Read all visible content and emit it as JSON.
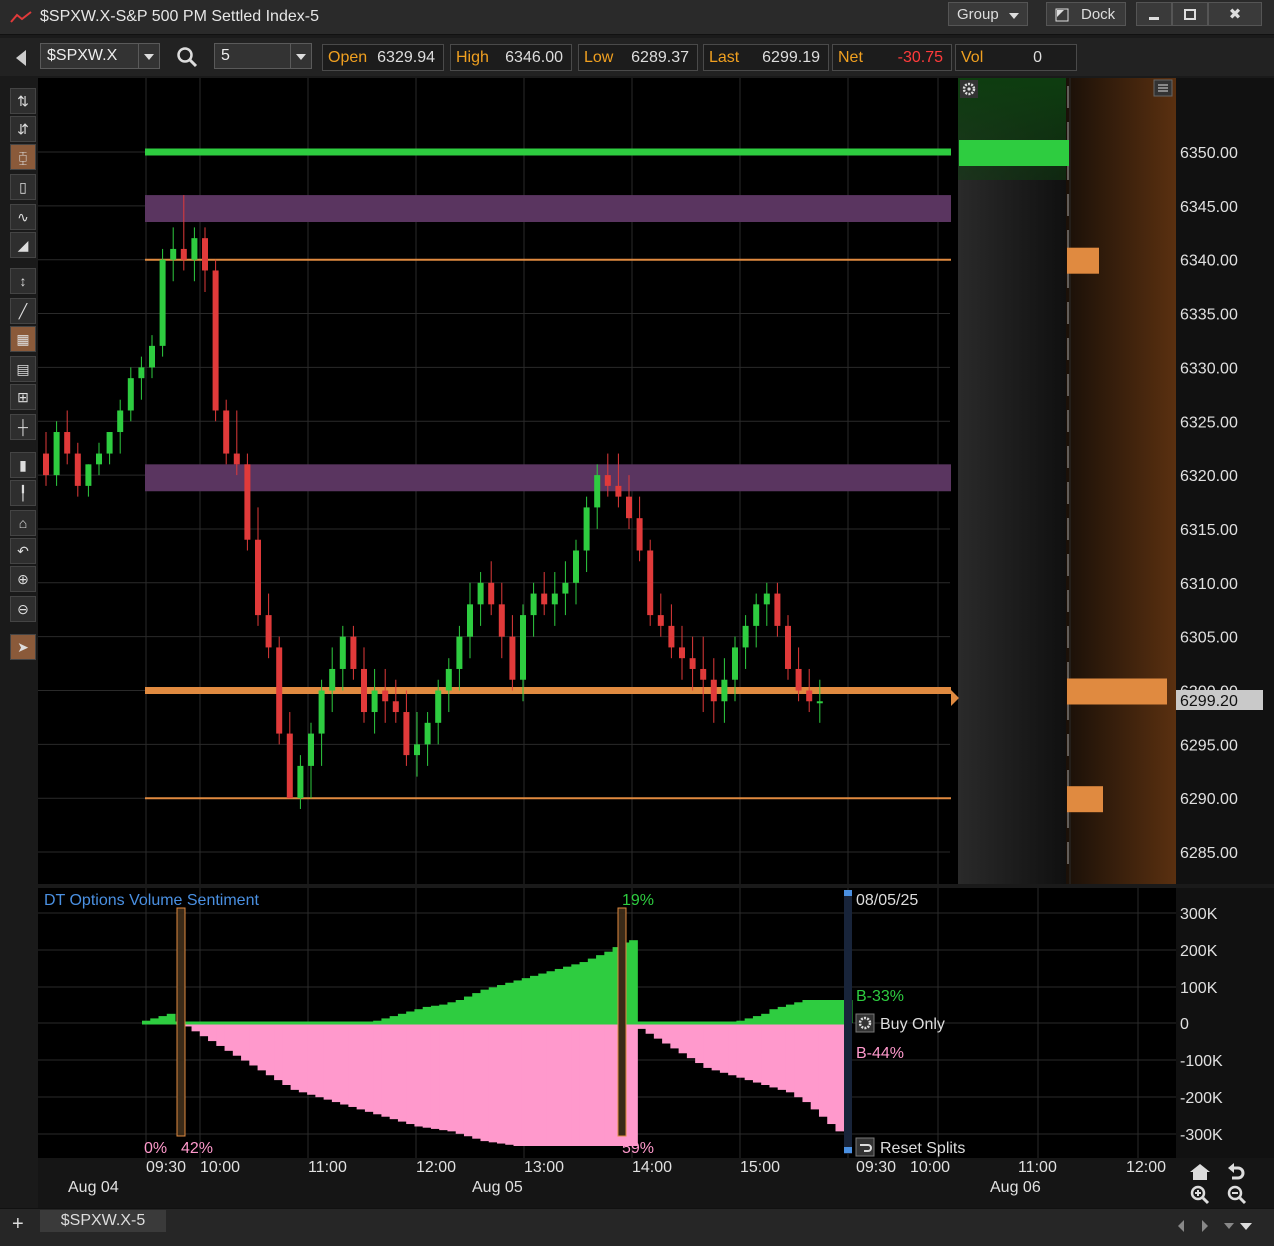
{
  "window": {
    "title": "$SPXW.X-S&P 500 PM Settled Index-5",
    "group_label": "Group",
    "dock_label": "Dock",
    "minimize_icon": "minimize-icon",
    "maximize_icon": "maximize-icon",
    "close_label": "✖"
  },
  "toolbar": {
    "symbol": "$SPXW.X",
    "interval": "5",
    "quotes": [
      {
        "label": "Open",
        "value": "6329.94"
      },
      {
        "label": "High",
        "value": "6346.00"
      },
      {
        "label": "Low",
        "value": "6289.37"
      },
      {
        "label": "Last",
        "value": "6299.19"
      },
      {
        "label": "Net",
        "value": "-30.75"
      },
      {
        "label": "Vol",
        "value": "0"
      }
    ],
    "net_color": "#ff3b3b",
    "label_color": "#f0a020"
  },
  "price_axis": {
    "ticks": [
      "6350.00",
      "6345.00",
      "6340.00",
      "6335.00",
      "6330.00",
      "6325.00",
      "6320.00",
      "6315.00",
      "6310.00",
      "6305.00",
      "6300.00",
      "6295.00",
      "6290.00",
      "6285.00"
    ],
    "last_price_tag": "6299.20"
  },
  "volume_panel": {
    "title": "DT Options Volume Sentiment",
    "date_label": "08/05/25",
    "buy_pct": "B-33%",
    "sell_pct": "B-44%",
    "buy_only_label": "Buy Only",
    "reset_splits_label": "Reset Splits",
    "split_labels": {
      "start": "0%",
      "first": "42%",
      "peak": "19%",
      "second": "59%"
    },
    "axis_ticks": [
      "300K",
      "200K",
      "100K",
      "0",
      "-100K",
      "-200K",
      "-300K"
    ],
    "buy_color": "#2ecc40",
    "sell_color": "#ff99cc"
  },
  "time_axis": {
    "times": [
      "09:30",
      "10:00",
      "11:00",
      "12:00",
      "13:00",
      "14:00",
      "15:00",
      "09:30",
      "10:00",
      "11:00",
      "12:00"
    ],
    "dates": [
      "Aug 04",
      "Aug 05",
      "Aug 06"
    ]
  },
  "tabs": {
    "add_label": "+",
    "active_tab": "$SPXW.X-5"
  },
  "chart_data": {
    "type": "candlestick",
    "symbol": "$SPXW.X",
    "interval": "5",
    "ylim": [
      6283,
      6357
    ],
    "candles": [
      [
        6322,
        6324,
        6319,
        6320
      ],
      [
        6320,
        6325,
        6319,
        6324
      ],
      [
        6324,
        6326,
        6321,
        6322
      ],
      [
        6322,
        6323,
        6318,
        6319
      ],
      [
        6319,
        6321,
        6318,
        6321
      ],
      [
        6321,
        6323,
        6320,
        6322
      ],
      [
        6322,
        6324,
        6321,
        6324
      ],
      [
        6324,
        6327,
        6322,
        6326
      ],
      [
        6326,
        6330,
        6325,
        6329
      ],
      [
        6329,
        6331,
        6327,
        6330
      ],
      [
        6330,
        6333,
        6329,
        6332
      ],
      [
        6332,
        6341,
        6331,
        6340
      ],
      [
        6340,
        6343,
        6338,
        6341
      ],
      [
        6341,
        6346,
        6339,
        6340
      ],
      [
        6340,
        6343,
        6338,
        6342
      ],
      [
        6342,
        6343,
        6337,
        6339
      ],
      [
        6339,
        6340,
        6325,
        6326
      ],
      [
        6326,
        6327,
        6321,
        6322
      ],
      [
        6322,
        6326,
        6320,
        6321
      ],
      [
        6321,
        6322,
        6313,
        6314
      ],
      [
        6314,
        6317,
        6306,
        6307
      ],
      [
        6307,
        6309,
        6303,
        6304
      ],
      [
        6304,
        6305,
        6295,
        6296
      ],
      [
        6296,
        6298,
        6290,
        6290
      ],
      [
        6290,
        6294,
        6289,
        6293
      ],
      [
        6293,
        6297,
        6290,
        6296
      ],
      [
        6296,
        6301,
        6293,
        6300
      ],
      [
        6300,
        6304,
        6298,
        6302
      ],
      [
        6302,
        6306,
        6300,
        6305
      ],
      [
        6305,
        6306,
        6301,
        6302
      ],
      [
        6302,
        6304,
        6297,
        6298
      ],
      [
        6298,
        6302,
        6296,
        6300
      ],
      [
        6300,
        6302,
        6297,
        6299
      ],
      [
        6299,
        6301,
        6297,
        6298
      ],
      [
        6298,
        6300,
        6293,
        6294
      ],
      [
        6294,
        6298,
        6292,
        6295
      ],
      [
        6295,
        6298,
        6293,
        6297
      ],
      [
        6297,
        6301,
        6295,
        6300
      ],
      [
        6300,
        6303,
        6298,
        6302
      ],
      [
        6302,
        6306,
        6300,
        6305
      ],
      [
        6305,
        6310,
        6303,
        6308
      ],
      [
        6308,
        6311,
        6306,
        6310
      ],
      [
        6310,
        6312,
        6307,
        6308
      ],
      [
        6308,
        6310,
        6303,
        6305
      ],
      [
        6305,
        6307,
        6300,
        6301
      ],
      [
        6301,
        6308,
        6299,
        6307
      ],
      [
        6307,
        6310,
        6305,
        6309
      ],
      [
        6309,
        6311,
        6307,
        6308
      ],
      [
        6308,
        6311,
        6306,
        6309
      ],
      [
        6309,
        6312,
        6307,
        6310
      ],
      [
        6310,
        6314,
        6308,
        6313
      ],
      [
        6313,
        6318,
        6311,
        6317
      ],
      [
        6317,
        6321,
        6315,
        6320
      ],
      [
        6320,
        6322,
        6318,
        6319
      ],
      [
        6319,
        6322,
        6317,
        6318
      ],
      [
        6318,
        6320,
        6315,
        6316
      ],
      [
        6316,
        6318,
        6312,
        6313
      ],
      [
        6313,
        6314,
        6306,
        6307
      ],
      [
        6307,
        6309,
        6305,
        6306
      ],
      [
        6306,
        6308,
        6303,
        6304
      ],
      [
        6304,
        6306,
        6301,
        6303
      ],
      [
        6303,
        6305,
        6300,
        6302
      ],
      [
        6302,
        6305,
        6298,
        6301
      ],
      [
        6301,
        6303,
        6297,
        6299
      ],
      [
        6299,
        6303,
        6297,
        6301
      ],
      [
        6301,
        6305,
        6299,
        6304
      ],
      [
        6304,
        6307,
        6302,
        6306
      ],
      [
        6306,
        6309,
        6304,
        6308
      ],
      [
        6308,
        6310,
        6306,
        6309
      ],
      [
        6309,
        6310,
        6305,
        6306
      ],
      [
        6306,
        6307,
        6301,
        6302
      ],
      [
        6302,
        6304,
        6299,
        6300
      ],
      [
        6300,
        6302,
        6298,
        6299
      ],
      [
        6299,
        6301,
        6297,
        6299
      ]
    ],
    "levels": [
      {
        "price": 6350,
        "color": "#2ecc40",
        "width": "thick"
      },
      {
        "price": 6340,
        "color": "#e08a40",
        "width": "thin"
      },
      {
        "price": 6300,
        "color": "#e08a40",
        "width": "thick"
      },
      {
        "price": 6290,
        "color": "#e08a40",
        "width": "thin"
      }
    ],
    "zones": [
      {
        "from": 6343.5,
        "to": 6346,
        "color": "#5a3560"
      },
      {
        "from": 6318.5,
        "to": 6321,
        "color": "#5a3560"
      }
    ],
    "volume_profile": [
      {
        "price": 6350,
        "color": "#2ecc40",
        "size": 0.5
      },
      {
        "price": 6340,
        "color": "#e08a40",
        "size": 0.16
      },
      {
        "price": 6300,
        "color": "#e08a40",
        "size": 0.5
      },
      {
        "price": 6290,
        "color": "#e08a40",
        "size": 0.18
      }
    ],
    "sentiment": {
      "buy": [
        0.02,
        0.04,
        0.06,
        0.08,
        0,
        0,
        0,
        0,
        0,
        0,
        0,
        0,
        0,
        0,
        0,
        0,
        0,
        0,
        0,
        0,
        0,
        0,
        0,
        0,
        0,
        0,
        0,
        0,
        0.02,
        0.04,
        0.06,
        0.08,
        0.1,
        0.12,
        0.14,
        0.15,
        0.16,
        0.18,
        0.2,
        0.23,
        0.26,
        0.29,
        0.31,
        0.33,
        0.35,
        0.37,
        0.39,
        0.41,
        0.43,
        0.45,
        0.47,
        0.49,
        0.51,
        0.53,
        0.56,
        0.59,
        0.62,
        0.66,
        0.7,
        0.72,
        0,
        0,
        0,
        0,
        0,
        0,
        0,
        0,
        0,
        0,
        0,
        0,
        0.02,
        0.04,
        0.06,
        0.08,
        0.12,
        0.14,
        0.16,
        0.18,
        0.2,
        0.2,
        0.2,
        0.2,
        0.2,
        0.2
      ],
      "sell": [
        0,
        0,
        0,
        0,
        0,
        0.02,
        0.06,
        0.1,
        0.14,
        0.18,
        0.22,
        0.26,
        0.3,
        0.34,
        0.38,
        0.42,
        0.46,
        0.5,
        0.54,
        0.56,
        0.58,
        0.6,
        0.62,
        0.64,
        0.66,
        0.68,
        0.7,
        0.72,
        0.74,
        0.76,
        0.78,
        0.8,
        0.82,
        0.84,
        0.85,
        0.86,
        0.87,
        0.88,
        0.9,
        0.92,
        0.94,
        0.96,
        0.97,
        0.98,
        0.99,
        1,
        1,
        1,
        1,
        1,
        1,
        1,
        1,
        1,
        1,
        1,
        1,
        1,
        1,
        1,
        0.04,
        0.08,
        0.12,
        0.16,
        0.2,
        0.24,
        0.28,
        0.32,
        0.36,
        0.38,
        0.4,
        0.42,
        0.44,
        0.46,
        0.48,
        0.5,
        0.52,
        0.54,
        0.56,
        0.6,
        0.64,
        0.7,
        0.76,
        0.82,
        0.88
      ]
    }
  }
}
